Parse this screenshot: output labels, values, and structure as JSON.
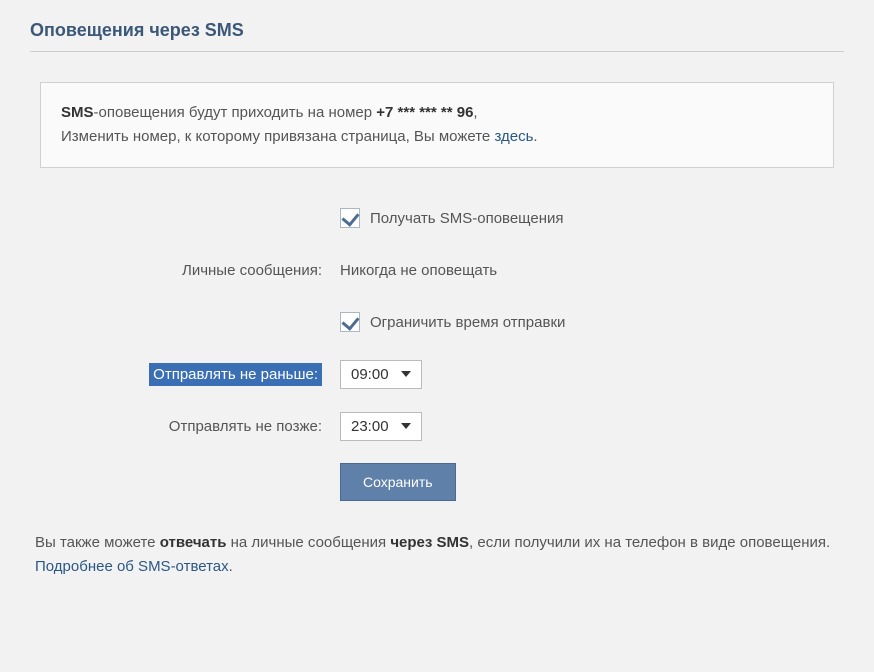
{
  "section_title": "Оповещения через SMS",
  "info_box": {
    "prefix_bold": "SMS",
    "line1_rest": "-оповещения будут приходить на номер ",
    "phone": "+7 *** *** ** 96",
    "line1_end": ",",
    "line2_start": "Изменить номер, к которому привязана страница, Вы можете ",
    "link": "здесь",
    "line2_end": "."
  },
  "form": {
    "receive_sms": {
      "label": "Получать SMS-оповещения"
    },
    "private_messages": {
      "label": "Личные сообщения:",
      "value": "Никогда не оповещать"
    },
    "limit_time": {
      "label": "Ограничить время отправки"
    },
    "send_not_before": {
      "label": "Отправлять не раньше:",
      "value": "09:00"
    },
    "send_not_after": {
      "label": "Отправлять не позже:",
      "value": "23:00"
    },
    "save_button": "Сохранить"
  },
  "footer": {
    "part1": "Вы также можете ",
    "bold1": "отвечать",
    "part2": " на личные сообщения ",
    "bold2": "через SMS",
    "part3": ", если получили их на телефон в виде оповещения. ",
    "link": "Подробнее об SMS-ответах",
    "end": "."
  }
}
